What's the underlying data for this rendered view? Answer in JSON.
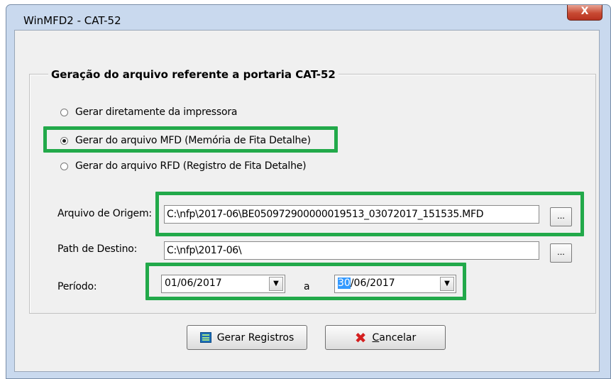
{
  "window": {
    "title": "WinMFD2 - CAT-52",
    "close_glyph": "X"
  },
  "group": {
    "title": "Geração do arquivo referente a portaria CAT-52"
  },
  "radios": [
    {
      "label": "Gerar diretamente da impressora",
      "checked": false
    },
    {
      "label": "Gerar do arquivo MFD (Memória de Fita Detalhe)",
      "checked": true
    },
    {
      "label": "Gerar do arquivo RFD (Registro de Fita Detalhe)",
      "checked": false
    }
  ],
  "origem": {
    "label": "Arquivo de Origem:",
    "value": "C:\\nfp\\2017-06\\BE050972900000019513_03072017_151535.MFD",
    "browse": "..."
  },
  "destino": {
    "label": "Path de Destino:",
    "value": "C:\\nfp\\2017-06\\",
    "browse": "..."
  },
  "periodo": {
    "label": "Período:",
    "from": "01/06/2017",
    "separator": "a",
    "to_selected": "30",
    "to_rest": "/06/2017"
  },
  "buttons": {
    "gerar": "Gerar Registros",
    "cancelar_first": "C",
    "cancelar_rest": "ancelar"
  },
  "colors": {
    "highlight_box": "#22a94a",
    "selection": "#3399ff",
    "cancel_icon": "#d41f1f"
  },
  "icons": {
    "gerar": "list-icon",
    "cancelar": "red-x-icon"
  }
}
